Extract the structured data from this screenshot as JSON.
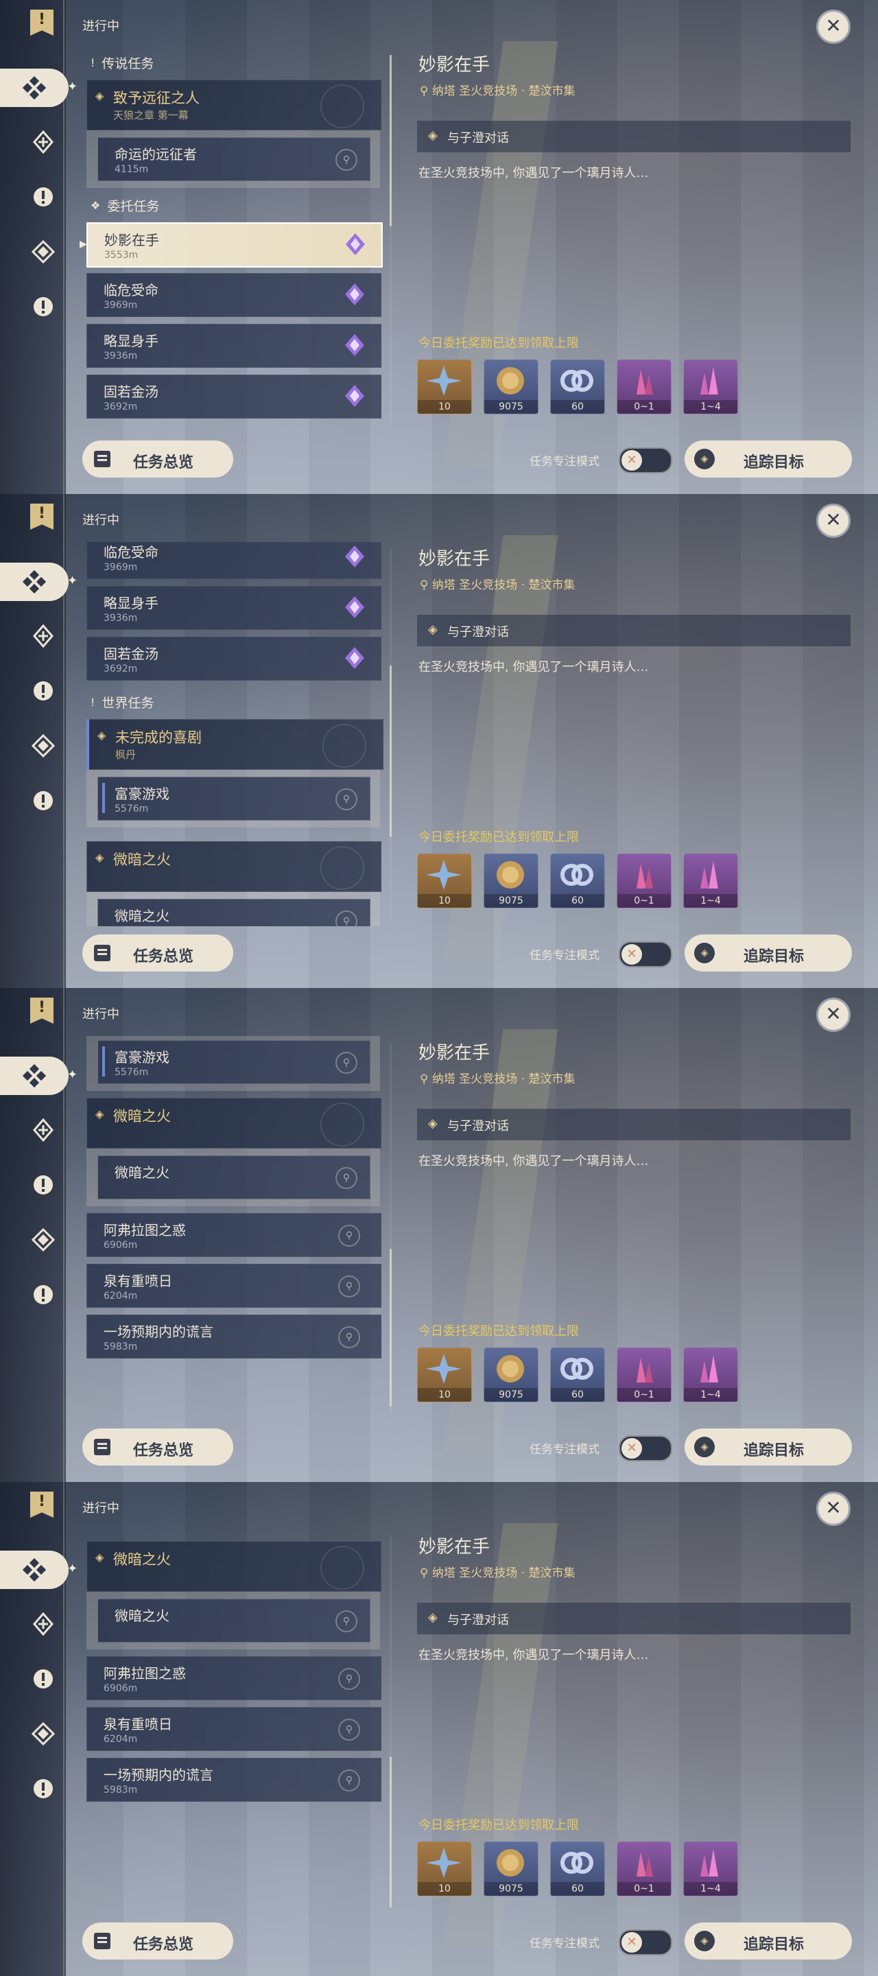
{
  "header": {
    "title": "进行中"
  },
  "sidebar": {
    "icons": [
      "bookmark-icon",
      "commission-icon",
      "archon-icon",
      "exclamation-icon",
      "world-icon",
      "exclamation-icon"
    ]
  },
  "sections": {
    "legend": "传说任务",
    "commission": "委托任务",
    "world": "世界任务"
  },
  "quests": {
    "legend_group": {
      "title": "致予远征之人",
      "subtitle": "天狼之章 第一幕"
    },
    "legend_sub": {
      "title": "命运的远征者",
      "distance": "4115m"
    },
    "commissions": [
      {
        "title": "妙影在手",
        "distance": "3553m"
      },
      {
        "title": "临危受命",
        "distance": "3969m"
      },
      {
        "title": "略显身手",
        "distance": "3936m"
      },
      {
        "title": "固若金汤",
        "distance": "3692m"
      }
    ],
    "world_group": {
      "title": "未完成的喜剧",
      "subtitle": "枫丹"
    },
    "world_sub": {
      "title": "富豪游戏",
      "distance": "5576m"
    },
    "faint_group": {
      "title": "微暗之火"
    },
    "faint_sub": {
      "title": "微暗之火"
    },
    "others": [
      {
        "title": "阿弗拉图之惑",
        "distance": "6906m"
      },
      {
        "title": "泉有重喷日",
        "distance": "6204m"
      },
      {
        "title": "一场预期内的谎言",
        "distance": "5983m"
      }
    ]
  },
  "detail": {
    "title": "妙影在手",
    "location": "纳塔 圣火竞技场 · 楚汶市集",
    "objective": "与子澄对话",
    "description": "在圣火竞技场中, 你遇见了一个璃月诗人…",
    "reward_note": "今日委托奖励已达到领取上限",
    "rewards": [
      {
        "icon": "starglitter-icon",
        "count": "10",
        "tone": "gold"
      },
      {
        "icon": "mora-icon",
        "count": "9075",
        "tone": "blue"
      },
      {
        "icon": "friendship-icon",
        "count": "60",
        "tone": "blue"
      },
      {
        "icon": "crystal-icon",
        "count": "0~1",
        "tone": "purple"
      },
      {
        "icon": "crystal-cluster-icon",
        "count": "1~4",
        "tone": "purple"
      }
    ]
  },
  "footer": {
    "overview_label": "任务总览",
    "focus_label": "任务专注模式",
    "track_label": "追踪目标"
  },
  "colors": {
    "accent_gold": "#e9c95c",
    "text_light": "#ece5d6",
    "selected_bg": "#eee6d2",
    "world_bar": "#6c88d8"
  }
}
